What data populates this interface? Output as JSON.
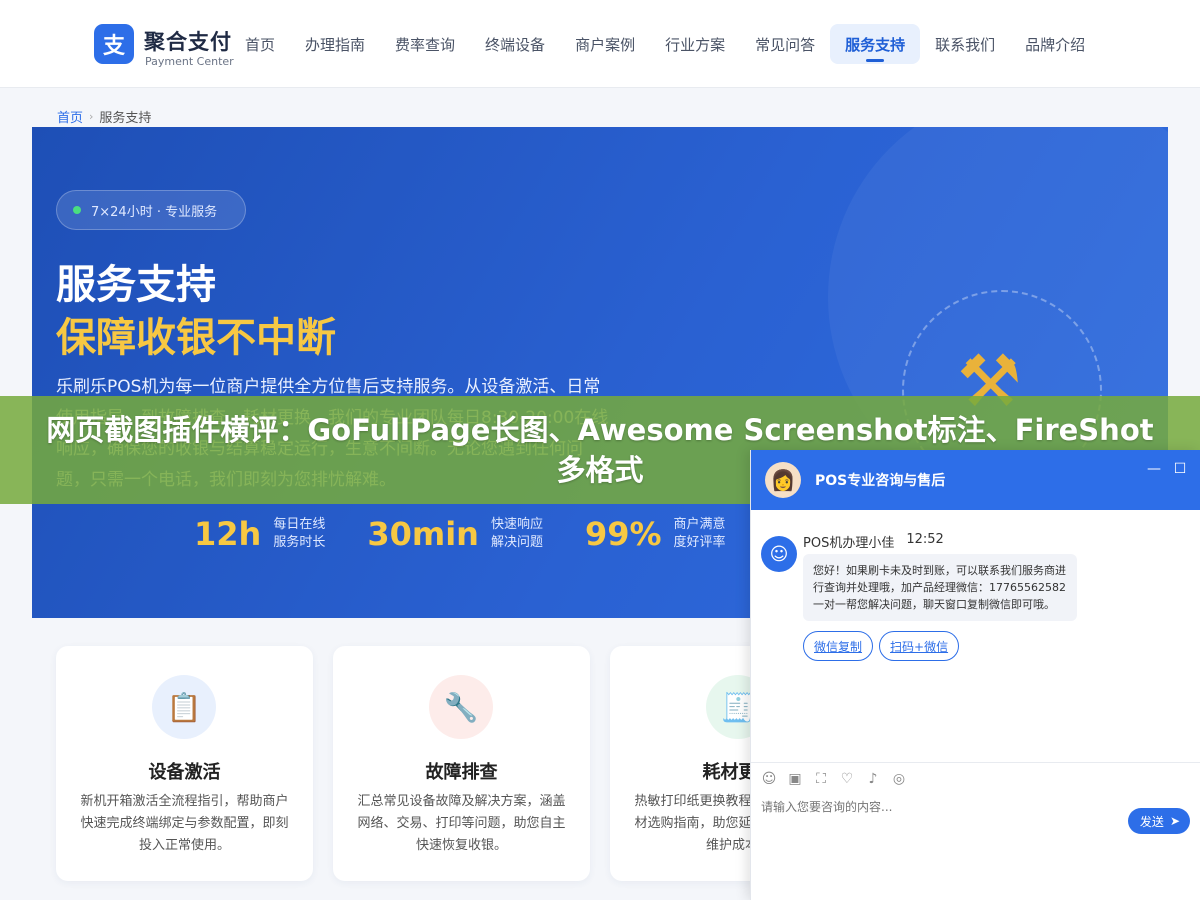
{
  "header": {
    "logo_char": "支",
    "logo_title": "聚合支付",
    "logo_subtitle": "Payment Center",
    "nav": [
      {
        "label": "首页"
      },
      {
        "label": "办理指南"
      },
      {
        "label": "费率查询"
      },
      {
        "label": "终端设备"
      },
      {
        "label": "商户案例"
      },
      {
        "label": "行业方案"
      },
      {
        "label": "常见问答"
      },
      {
        "label": "服务支持",
        "active": true
      },
      {
        "label": "联系我们"
      },
      {
        "label": "品牌介绍"
      }
    ]
  },
  "breadcrumb": {
    "home": "首页",
    "separator": "›",
    "current": "服务支持"
  },
  "hero": {
    "badge": "7×24小时 · 专业服务",
    "title": "服务支持",
    "subtitle": "保障收银不中断",
    "description": "乐刷乐POS机为每一位商户提供全方位售后支持服务。从设备激活、日常使用指导、到故障排查、耗材更换，我们的专业团队每日8:30-20:00在线响应，确保您的收银与结算稳定运行，生意不间断。无论您遇到任何问题，只需一个电话，我们即刻为您排忧解难。",
    "tools_icon": "hammer-wrench-icon",
    "stats": [
      {
        "value": "12h",
        "label": "每日在线服务时长"
      },
      {
        "value": "30min",
        "label": "快速响应解决问题"
      },
      {
        "value": "99%",
        "label": "商户满意度好评率"
      }
    ]
  },
  "cards": [
    {
      "icon": "clipboard-icon",
      "title": "设备激活",
      "desc": "新机开箱激活全流程指引，帮助商户快速完成终端绑定与参数配置，即刻投入正常使用。",
      "icon_bg": "#e8f0fd"
    },
    {
      "icon": "wrench-icon",
      "title": "故障排查",
      "desc": "汇总常见设备故障及解决方案，涵盖网络、交易、打印等问题，助您自主快速恢复收银。",
      "icon_bg": "#fdecea"
    },
    {
      "icon": "paper-roll-icon",
      "title": "耗材更换",
      "desc": "热敏打印纸更换教程与操作技巧及耗材选购指南，助您延长设备寿命降低维护成本。",
      "icon_bg": "#e7f7ee"
    }
  ],
  "overlay": {
    "text": "网页截图插件横评：GoFullPage长图、Awesome Screenshot标注、FireShot多格式"
  },
  "chat": {
    "header_title": "POS专业咨询与售后",
    "minimize": "—",
    "maximize": "☐",
    "agent_name": "POS机办理小佳",
    "time": "12:52",
    "message": "您好！如果刷卡未及时到账，可以联系我们服务商进行查询并处理哦，加产品经理微信：17765562582 一对一帮您解决问题，聊天窗口复制微信即可哦。",
    "action_copy": "微信复制",
    "action_scan": "扫码+微信",
    "tools": [
      "emoji-icon",
      "image-icon",
      "screenshot-icon",
      "rating-icon",
      "voice-icon",
      "wechat-icon"
    ],
    "input_placeholder": "请输入您要咨询的内容...",
    "send_label": "发送"
  },
  "colors": {
    "primary": "#2d6ee8",
    "accent_yellow": "#f7c843",
    "overlay_green": "#76aa3c"
  }
}
